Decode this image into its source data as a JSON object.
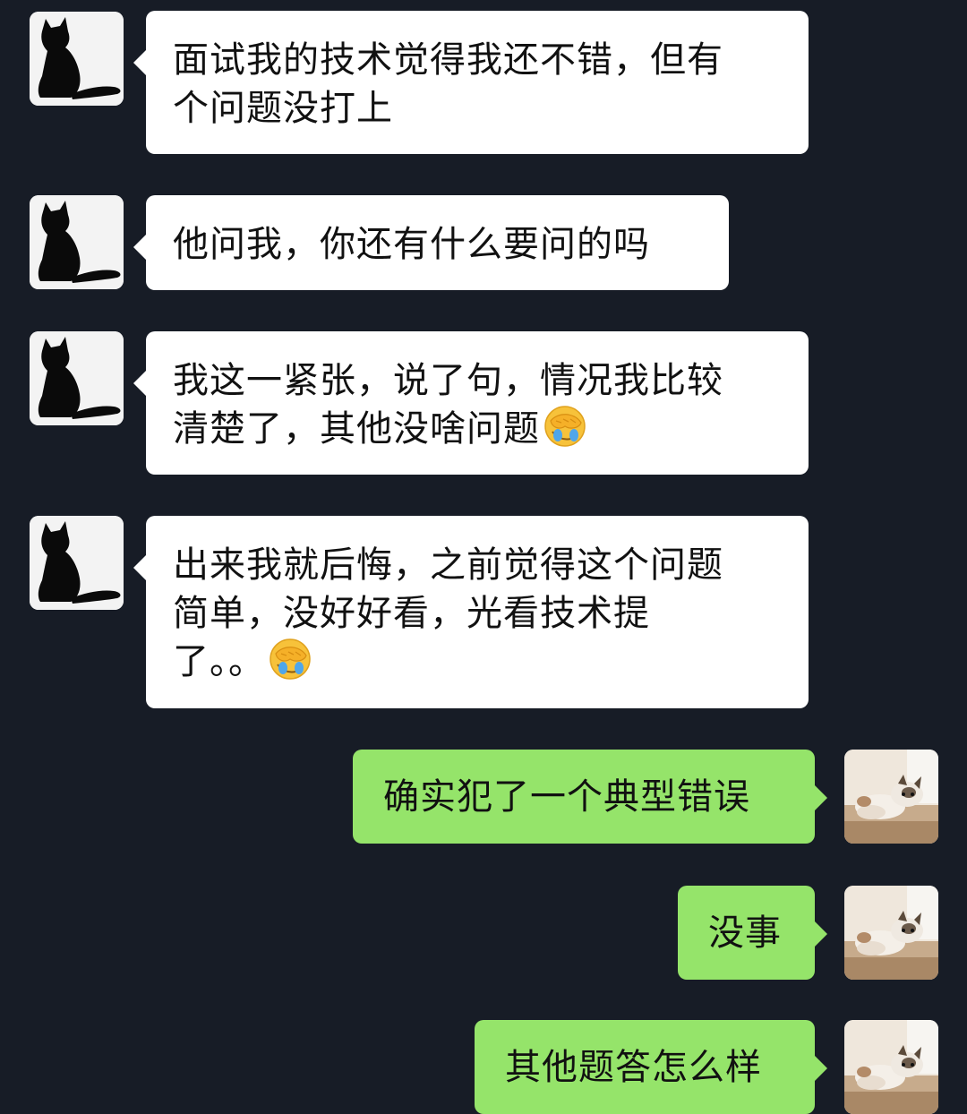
{
  "messages": [
    {
      "from": "other",
      "lines": [
        "面试我的技术觉得我还不错，但有",
        "个问题没打上"
      ],
      "emoji": ""
    },
    {
      "from": "other",
      "lines": [
        "他问我，你还有什么要问的吗"
      ],
      "emoji": ""
    },
    {
      "from": "other",
      "lines": [
        "我这一紧张，说了句，情况我比较",
        "清楚了，其他没啥问题"
      ],
      "emoji": "facepalm-emoji"
    },
    {
      "from": "other",
      "lines": [
        "出来我就后悔，之前觉得这个问题",
        "简单，没好好看，光看技术提",
        "了。。"
      ],
      "emoji": "facepalm-emoji"
    },
    {
      "from": "self",
      "lines": [
        "确实犯了一个典型错误"
      ]
    },
    {
      "from": "self",
      "lines": [
        "没事"
      ]
    },
    {
      "from": "self",
      "lines": [
        "其他题答怎么样"
      ]
    }
  ],
  "colors": {
    "background": "#171c26",
    "incoming_bubble": "#ffffff",
    "outgoing_bubble": "#95e46a"
  },
  "avatars": {
    "other": "black-cat-silhouette-avatar",
    "self": "dog-photo-avatar"
  }
}
